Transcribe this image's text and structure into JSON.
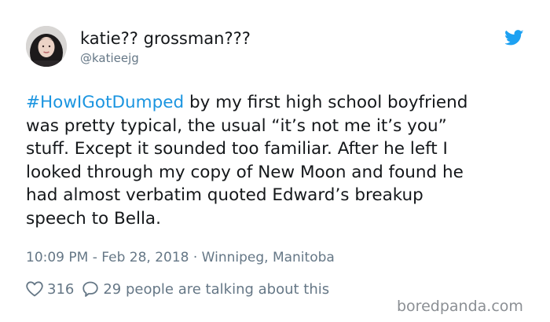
{
  "author": {
    "name": "katie?? grossman???",
    "handle": "@katieejg"
  },
  "tweet": {
    "hashtag": "#HowIGotDumped",
    "line1_rest": " by my first high school boyfriend",
    "line2": "was pretty typical, the usual “it’s not me it’s you”",
    "line3": "stuff. Except it sounded too familiar. After he left I",
    "line4": "looked through my copy of New Moon and found he",
    "line5": "had almost verbatim quoted Edward’s breakup",
    "line6": "speech to Bella."
  },
  "meta": "10:09 PM - Feb 28, 2018 · Winnipeg, Manitoba",
  "actions": {
    "likes": "316",
    "talking": "29 people are talking about this"
  },
  "watermark": "boredpanda.com",
  "icons": {
    "logo": "twitter-bird-icon",
    "like": "heart-icon",
    "reply": "speech-bubble-icon"
  },
  "colors": {
    "hashtag": "#1b95e0",
    "twitter_blue": "#1da1f2",
    "secondary_text": "#657786",
    "primary_text": "#14171a"
  }
}
